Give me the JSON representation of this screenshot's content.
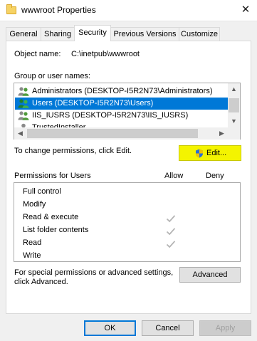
{
  "window": {
    "title": "wwwroot Properties",
    "close_glyph": "✕"
  },
  "tabs": [
    {
      "label": "General",
      "active": false
    },
    {
      "label": "Sharing",
      "active": false
    },
    {
      "label": "Security",
      "active": true
    },
    {
      "label": "Previous Versions",
      "active": false
    },
    {
      "label": "Customize",
      "active": false
    }
  ],
  "security": {
    "object_name_label": "Object name:",
    "object_name_value": "C:\\inetpub\\wwwroot",
    "group_label": "Group or user names:",
    "users": [
      {
        "name": "Administrators (DESKTOP-I5R2N73\\Administrators)",
        "selected": false
      },
      {
        "name": "Users (DESKTOP-I5R2N73\\Users)",
        "selected": true
      },
      {
        "name": "IIS_IUSRS (DESKTOP-I5R2N73\\IIS_IUSRS)",
        "selected": false
      },
      {
        "name": "TrustedInstaller",
        "selected": false
      }
    ],
    "change_hint": "To change permissions, click Edit.",
    "edit_button": "Edit...",
    "perms_header": "Permissions for Users",
    "allow_header": "Allow",
    "deny_header": "Deny",
    "permissions": [
      {
        "name": "Full control",
        "allow": false,
        "deny": false
      },
      {
        "name": "Modify",
        "allow": false,
        "deny": false
      },
      {
        "name": "Read & execute",
        "allow": true,
        "deny": false
      },
      {
        "name": "List folder contents",
        "allow": true,
        "deny": false
      },
      {
        "name": "Read",
        "allow": true,
        "deny": false
      },
      {
        "name": "Write",
        "allow": false,
        "deny": false
      }
    ],
    "advanced_hint_line1": "For special permissions or advanced settings,",
    "advanced_hint_line2": "click Advanced.",
    "advanced_button": "Advanced"
  },
  "footer": {
    "ok": "OK",
    "cancel": "Cancel",
    "apply": "Apply"
  },
  "colors": {
    "selection": "#0078d7",
    "edit_highlight": "#f4f400",
    "check_gray": "#b4b4b4"
  }
}
